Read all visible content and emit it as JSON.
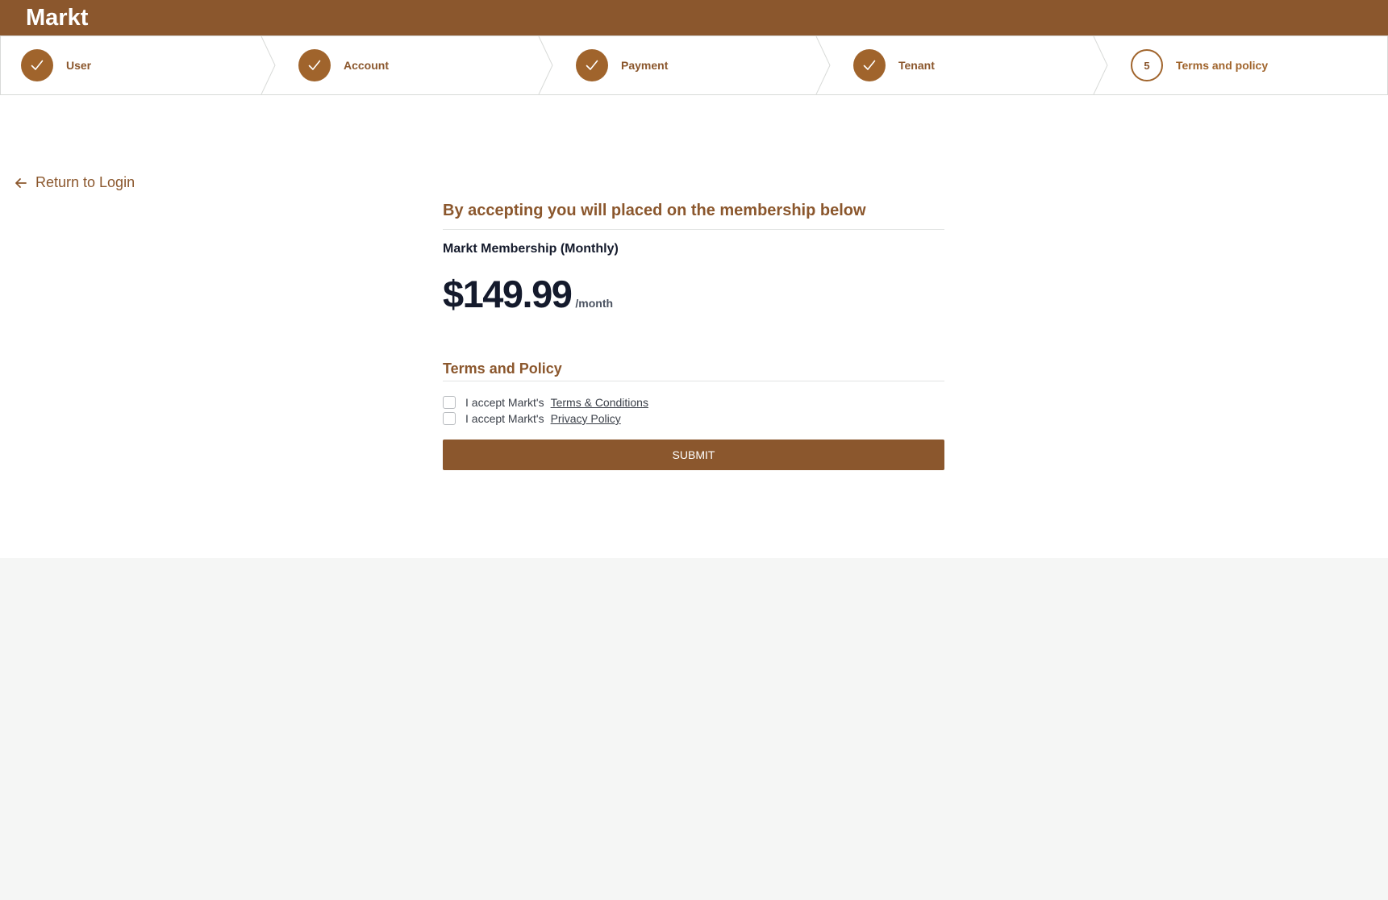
{
  "app": {
    "brand": "Markt"
  },
  "stepper": {
    "steps": [
      {
        "label": "User",
        "status": "complete",
        "icon": "check-icon"
      },
      {
        "label": "Account",
        "status": "complete",
        "icon": "check-icon"
      },
      {
        "label": "Payment",
        "status": "complete",
        "icon": "check-icon"
      },
      {
        "label": "Tenant",
        "status": "complete",
        "icon": "check-icon"
      },
      {
        "label": "Terms and policy",
        "status": "current",
        "number": "5"
      }
    ]
  },
  "nav": {
    "return_label": "Return to Login",
    "return_icon": "arrow-left-icon"
  },
  "membership": {
    "heading": "By accepting you will placed on the membership below",
    "plan_name": "Markt Membership (Monthly)",
    "price": "$149.99",
    "period": "/month"
  },
  "terms": {
    "heading": "Terms and Policy",
    "items": [
      {
        "prefix": "I accept Markt's",
        "link": "Terms & Conditions",
        "checked": false
      },
      {
        "prefix": "I accept Markt's",
        "link": "Privacy Policy",
        "checked": false
      }
    ]
  },
  "actions": {
    "submit_label": "SUBMIT"
  },
  "colors": {
    "brand": "#8b572d",
    "accent": "#a0642c",
    "text_dark": "#141a2c",
    "page_background": "#f5f6f5"
  }
}
